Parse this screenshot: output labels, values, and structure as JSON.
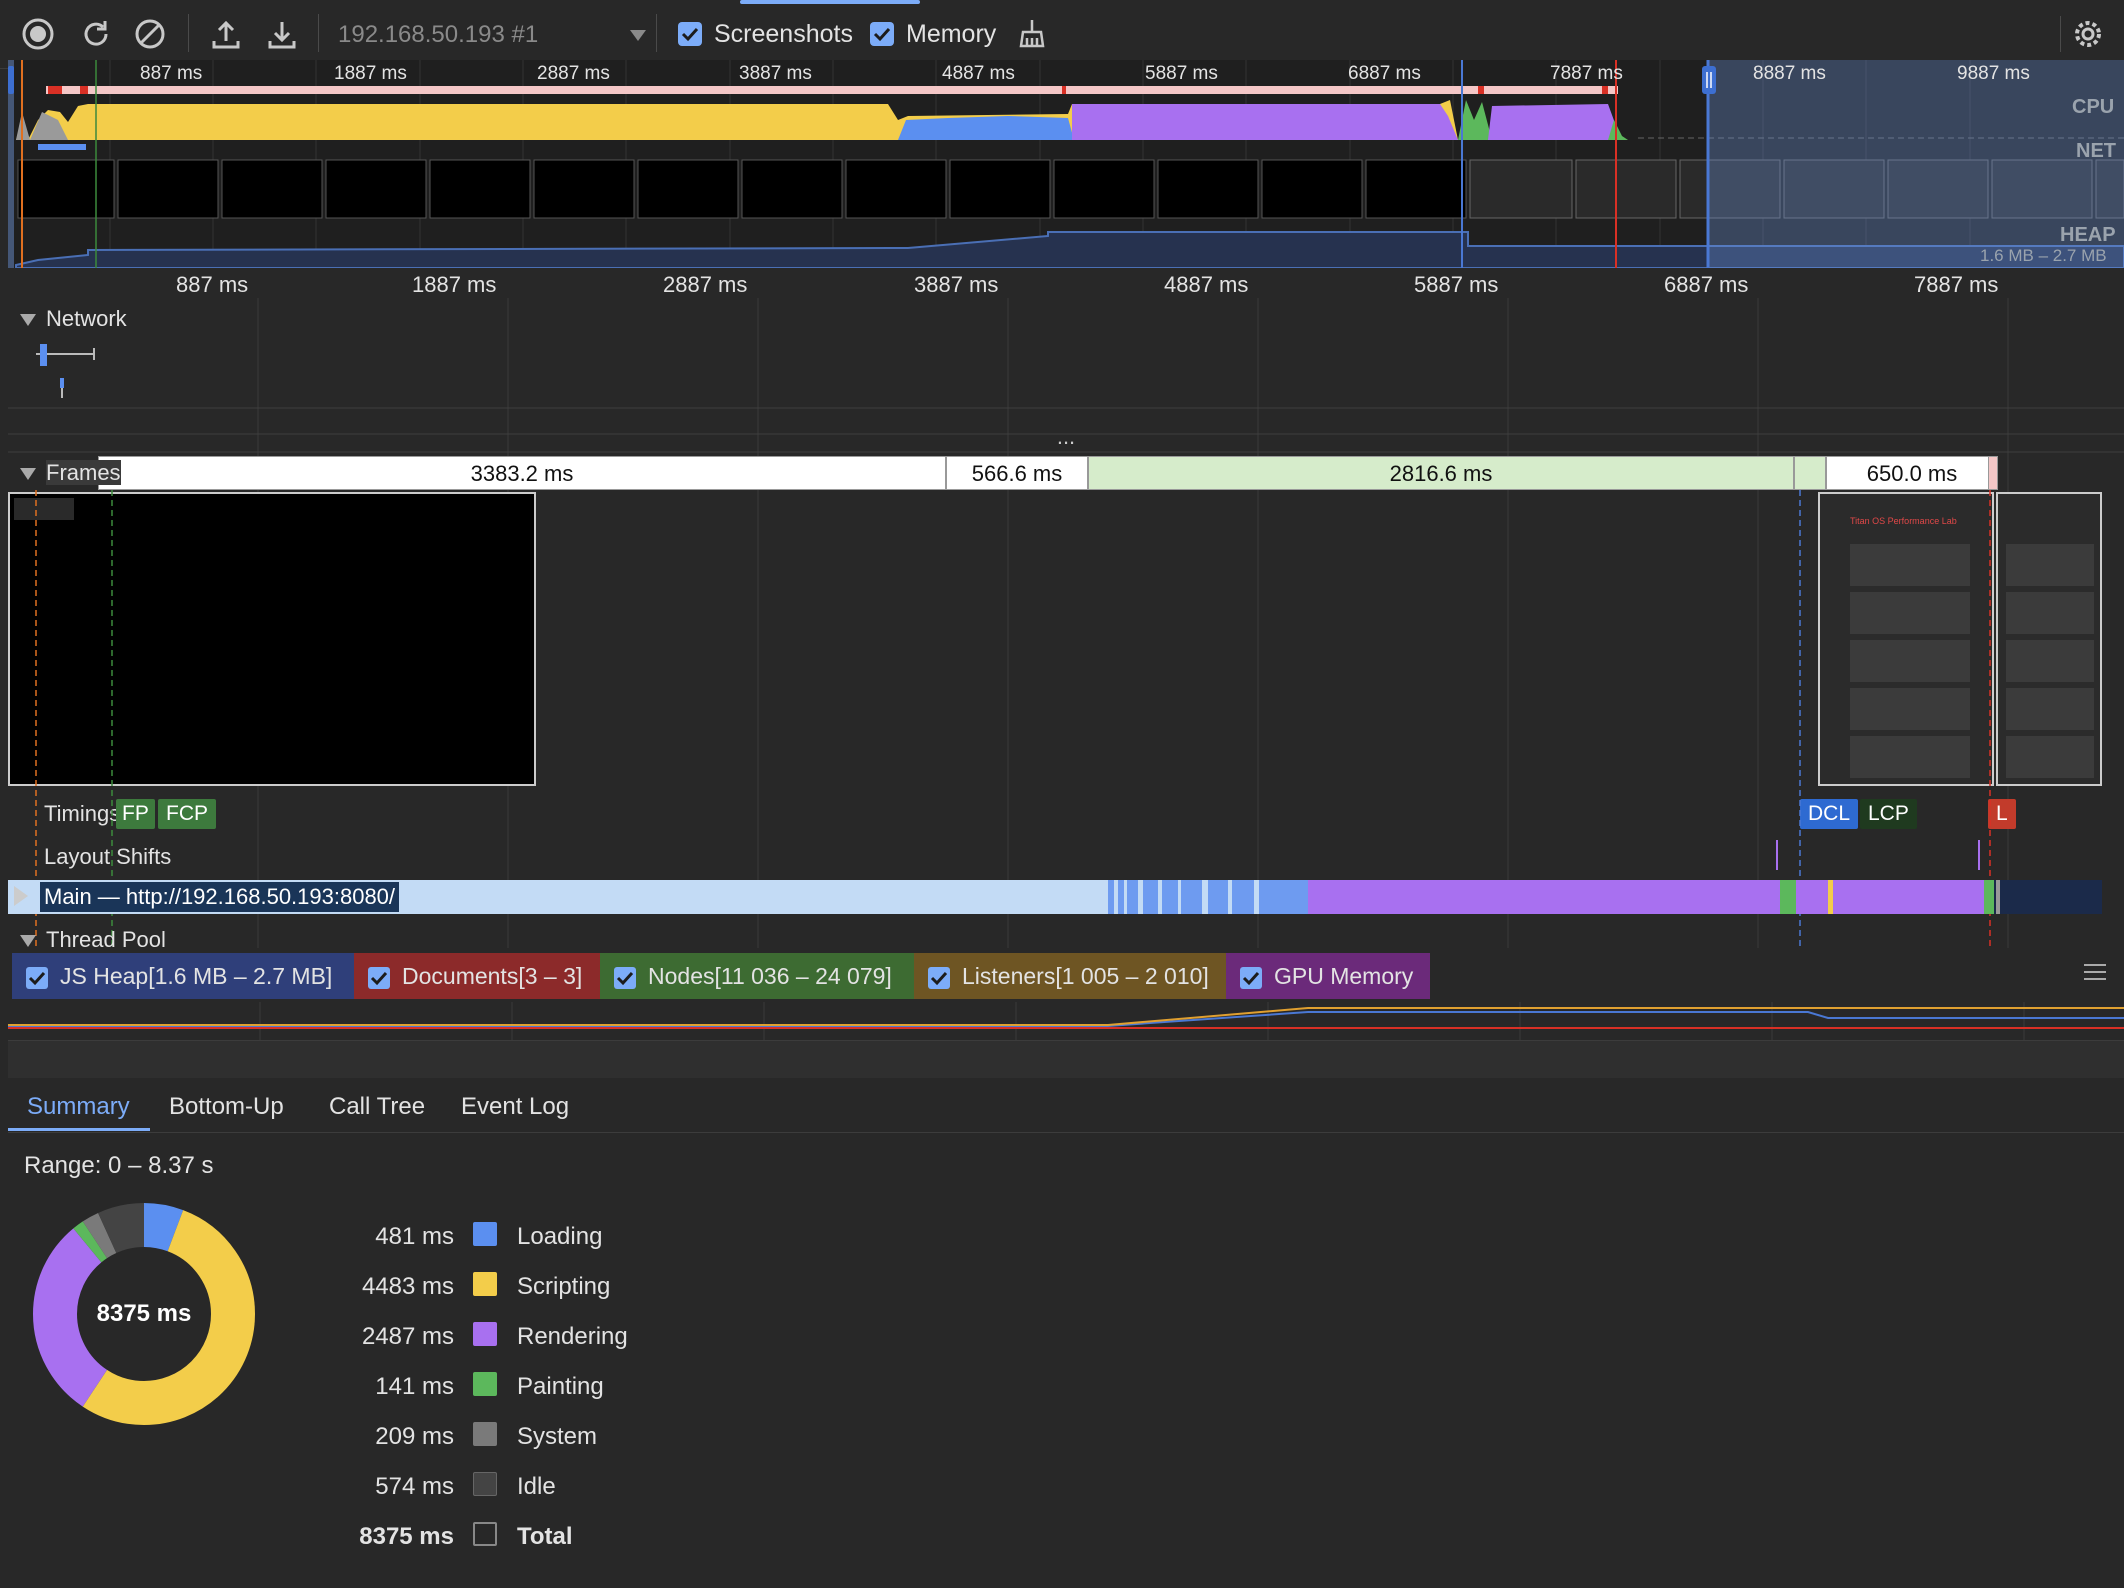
{
  "toolbar": {
    "target": "192.168.50.193 #1",
    "screenshots_label": "Screenshots",
    "memory_label": "Memory"
  },
  "overview": {
    "ticks": [
      "887 ms",
      "1887 ms",
      "2887 ms",
      "3887 ms",
      "4887 ms",
      "5887 ms",
      "6887 ms",
      "7887 ms",
      "8887 ms",
      "9887 ms"
    ],
    "cpu_label": "CPU",
    "net_label": "NET",
    "heap_label": "HEAP",
    "heap_range": "1.6 MB – 2.7 MB"
  },
  "ruler": {
    "ticks": [
      "887 ms",
      "1887 ms",
      "2887 ms",
      "3887 ms",
      "4887 ms",
      "5887 ms",
      "6887 ms",
      "7887 ms"
    ]
  },
  "tracks": {
    "network": "Network",
    "frames": "Frames",
    "frame_durations": [
      "3383.2 ms",
      "566.6 ms",
      "2816.6 ms",
      "650.0 ms"
    ],
    "timings": "Timings",
    "timing_badges": [
      "FP",
      "FCP",
      "DCL",
      "LCP",
      "L"
    ],
    "layout_shifts": "Layout Shifts",
    "main": "Main — http://192.168.50.193:8080/",
    "thread_pool": "Thread Pool",
    "screenshot_title": "Titan OS Performance Lab"
  },
  "counters": [
    {
      "label": "JS Heap[1.6 MB – 2.7 MB]",
      "color": "#2f3f7a"
    },
    {
      "label": "Documents[3 – 3]",
      "color": "#8c2a2a"
    },
    {
      "label": "Nodes[11 036 – 24 079]",
      "color": "#3d6b32"
    },
    {
      "label": "Listeners[1 005 – 2 010]",
      "color": "#6e5523"
    },
    {
      "label": "GPU Memory",
      "color": "#6b2a7a"
    }
  ],
  "tabs": [
    "Summary",
    "Bottom-Up",
    "Call Tree",
    "Event Log"
  ],
  "active_tab": "Summary",
  "summary": {
    "range": "Range: 0 – 8.37 s",
    "total_center": "8375 ms",
    "rows": [
      {
        "value": "481 ms",
        "label": "Loading",
        "color": "#5b8ff0"
      },
      {
        "value": "4483 ms",
        "label": "Scripting",
        "color": "#f3cd4a"
      },
      {
        "value": "2487 ms",
        "label": "Rendering",
        "color": "#a870f0"
      },
      {
        "value": "141 ms",
        "label": "Painting",
        "color": "#5cb85c"
      },
      {
        "value": "209 ms",
        "label": "System",
        "color": "#7a7a7a"
      },
      {
        "value": "574 ms",
        "label": "Idle",
        "color": "#444444"
      },
      {
        "value": "8375 ms",
        "label": "Total",
        "color": "transparent"
      }
    ]
  }
}
